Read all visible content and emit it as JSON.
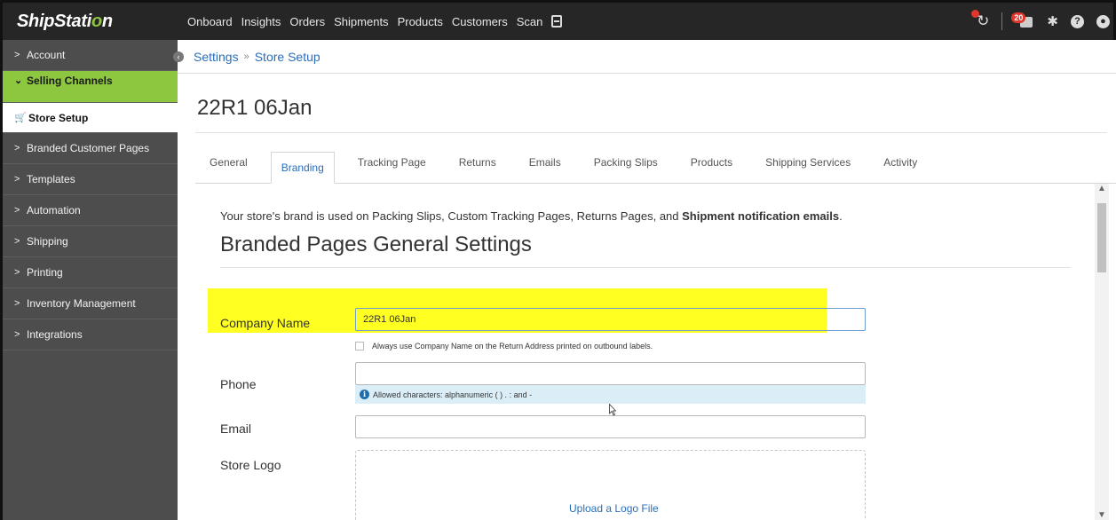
{
  "topbar": {
    "logo_main": "ShipStati",
    "logo_o": "o",
    "logo_n": "n",
    "nav": [
      "Onboard",
      "Insights",
      "Orders",
      "Shipments",
      "Products",
      "Customers",
      "Scan"
    ],
    "printer_badge": "20"
  },
  "sidebar": {
    "items": [
      {
        "label": "Account"
      },
      {
        "label": "Selling Channels"
      },
      {
        "label": "Store Setup"
      },
      {
        "label": "Branded Customer Pages"
      },
      {
        "label": "Templates"
      },
      {
        "label": "Automation"
      },
      {
        "label": "Shipping"
      },
      {
        "label": "Printing"
      },
      {
        "label": "Inventory Management"
      },
      {
        "label": "Integrations"
      }
    ]
  },
  "breadcrumb": {
    "root": "Settings",
    "separator": "»",
    "current": "Store Setup"
  },
  "page_title": "22R1 06Jan",
  "tabs": [
    "General",
    "Branding",
    "Tracking Page",
    "Returns",
    "Emails",
    "Packing Slips",
    "Products",
    "Shipping Services",
    "Activity"
  ],
  "active_tab": "Branding",
  "intro": {
    "text": "Your store's brand is used on Packing Slips, Custom Tracking Pages, Returns Pages, and ",
    "bold": "Shipment notification emails",
    "end": "."
  },
  "section_title": "Branded Pages General Settings",
  "form": {
    "company_label": "Company Name",
    "company_value": "22R1 06Jan",
    "checkbox_label": "Always use Company Name on the Return Address printed on outbound labels.",
    "phone_label": "Phone",
    "phone_value": "",
    "phone_hint": "Allowed characters: alphanumeric ( ) . : and -",
    "email_label": "Email",
    "email_value": "",
    "logo_label": "Store Logo",
    "upload_link": "Upload a Logo File"
  },
  "colors": {
    "accent_green": "#8dc63f",
    "link_blue": "#2a6ebb",
    "highlight": "#ffff22"
  }
}
